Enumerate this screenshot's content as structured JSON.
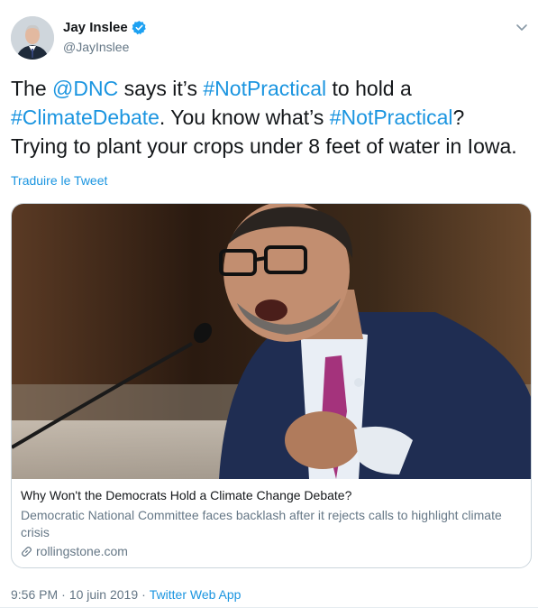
{
  "author": {
    "name": "Jay Inslee",
    "handle": "@JayInslee",
    "avatar_icon": "user-avatar-photo",
    "verified_icon": "verified-badge-icon"
  },
  "tweet": {
    "parts": [
      {
        "text": "The ",
        "link": false
      },
      {
        "text": "@DNC",
        "link": true
      },
      {
        "text": " says it’s ",
        "link": false
      },
      {
        "text": "#NotPractical",
        "link": true
      },
      {
        "text": " to hold a ",
        "link": false
      },
      {
        "text": "#ClimateDebate",
        "link": true
      },
      {
        "text": ". You know what’s ",
        "link": false
      },
      {
        "text": "#NotPractical",
        "link": true
      },
      {
        "text": "? Trying to plant your crops under 8 feet of water in Iowa.",
        "link": false
      }
    ]
  },
  "translate_label": "Traduire le Tweet",
  "card": {
    "title": "Why Won't the Democrats Hold a Climate Change Debate?",
    "description": "Democratic National Committee faces backlash after it rejects calls to highlight climate crisis",
    "domain": "rollingstone.com",
    "image_icon": "speaker-at-microphone-photo"
  },
  "meta": {
    "time": "9:56 PM",
    "separator1": "·",
    "date": "10 juin 2019",
    "separator2": "·",
    "app": "Twitter Web App"
  },
  "colors": {
    "link": "#1b95e0",
    "secondary_text": "#657786",
    "border": "#ccd6dd"
  }
}
